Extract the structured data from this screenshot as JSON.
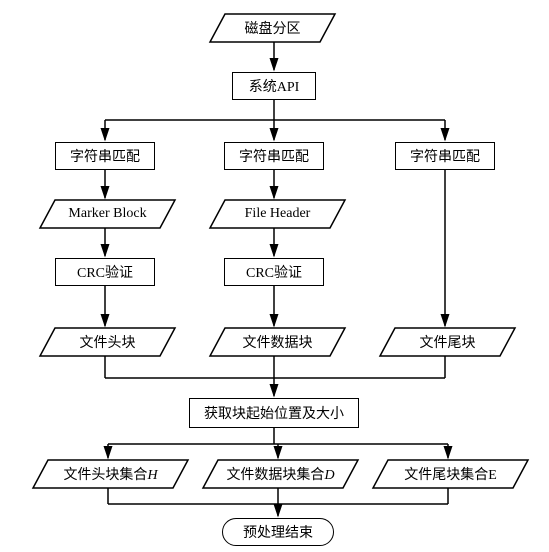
{
  "chart_data": {
    "type": "flowchart",
    "nodes": [
      {
        "id": "n0",
        "label": "磁盘分区",
        "shape": "parallelogram"
      },
      {
        "id": "n1",
        "label": "系统API",
        "shape": "rect"
      },
      {
        "id": "b1a",
        "label": "字符串匹配",
        "shape": "rect"
      },
      {
        "id": "b1b",
        "label": "Marker Block",
        "shape": "parallelogram"
      },
      {
        "id": "b1c",
        "label": "CRC验证",
        "shape": "rect"
      },
      {
        "id": "b1d",
        "label": "文件头块",
        "shape": "parallelogram"
      },
      {
        "id": "b2a",
        "label": "字符串匹配",
        "shape": "rect"
      },
      {
        "id": "b2b",
        "label": "File Header",
        "shape": "parallelogram"
      },
      {
        "id": "b2c",
        "label": "CRC验证",
        "shape": "rect"
      },
      {
        "id": "b2d",
        "label": "文件数据块",
        "shape": "parallelogram"
      },
      {
        "id": "b3a",
        "label": "字符串匹配",
        "shape": "rect"
      },
      {
        "id": "b3d",
        "label": "文件尾块",
        "shape": "parallelogram"
      },
      {
        "id": "m1",
        "label": "获取块起始位置及大小",
        "shape": "rect"
      },
      {
        "id": "o1",
        "label": "文件头块集合H",
        "shape": "parallelogram"
      },
      {
        "id": "o2",
        "label": "文件数据块集合D",
        "shape": "parallelogram"
      },
      {
        "id": "o3",
        "label": "文件尾块集合E",
        "shape": "parallelogram"
      },
      {
        "id": "end",
        "label": "预处理结束",
        "shape": "terminator"
      }
    ],
    "edges": [
      [
        "n0",
        "n1"
      ],
      [
        "n1",
        "b1a"
      ],
      [
        "n1",
        "b2a"
      ],
      [
        "n1",
        "b3a"
      ],
      [
        "b1a",
        "b1b"
      ],
      [
        "b1b",
        "b1c"
      ],
      [
        "b1c",
        "b1d"
      ],
      [
        "b2a",
        "b2b"
      ],
      [
        "b2b",
        "b2c"
      ],
      [
        "b2c",
        "b2d"
      ],
      [
        "b3a",
        "b3d"
      ],
      [
        "b1d",
        "m1"
      ],
      [
        "b2d",
        "m1"
      ],
      [
        "b3d",
        "m1"
      ],
      [
        "m1",
        "o1"
      ],
      [
        "m1",
        "o2"
      ],
      [
        "m1",
        "o3"
      ],
      [
        "o1",
        "end"
      ],
      [
        "o2",
        "end"
      ],
      [
        "o3",
        "end"
      ]
    ]
  },
  "n0": "磁盘分区",
  "n1": "系统API",
  "b1a": "字符串匹配",
  "b1b": "Marker Block",
  "b1c": "CRC验证",
  "b1d": "文件头块",
  "b2a": "字符串匹配",
  "b2b": "File Header",
  "b2c": "CRC验证",
  "b2d": "文件数据块",
  "b3a": "字符串匹配",
  "b3d": "文件尾块",
  "m1": "获取块起始位置及大小",
  "o1": "文件头块集合",
  "o1_suffix": "H",
  "o2": "文件数据块集合",
  "o2_suffix": "D",
  "o3": "文件尾块集合E",
  "end": "预处理结束"
}
